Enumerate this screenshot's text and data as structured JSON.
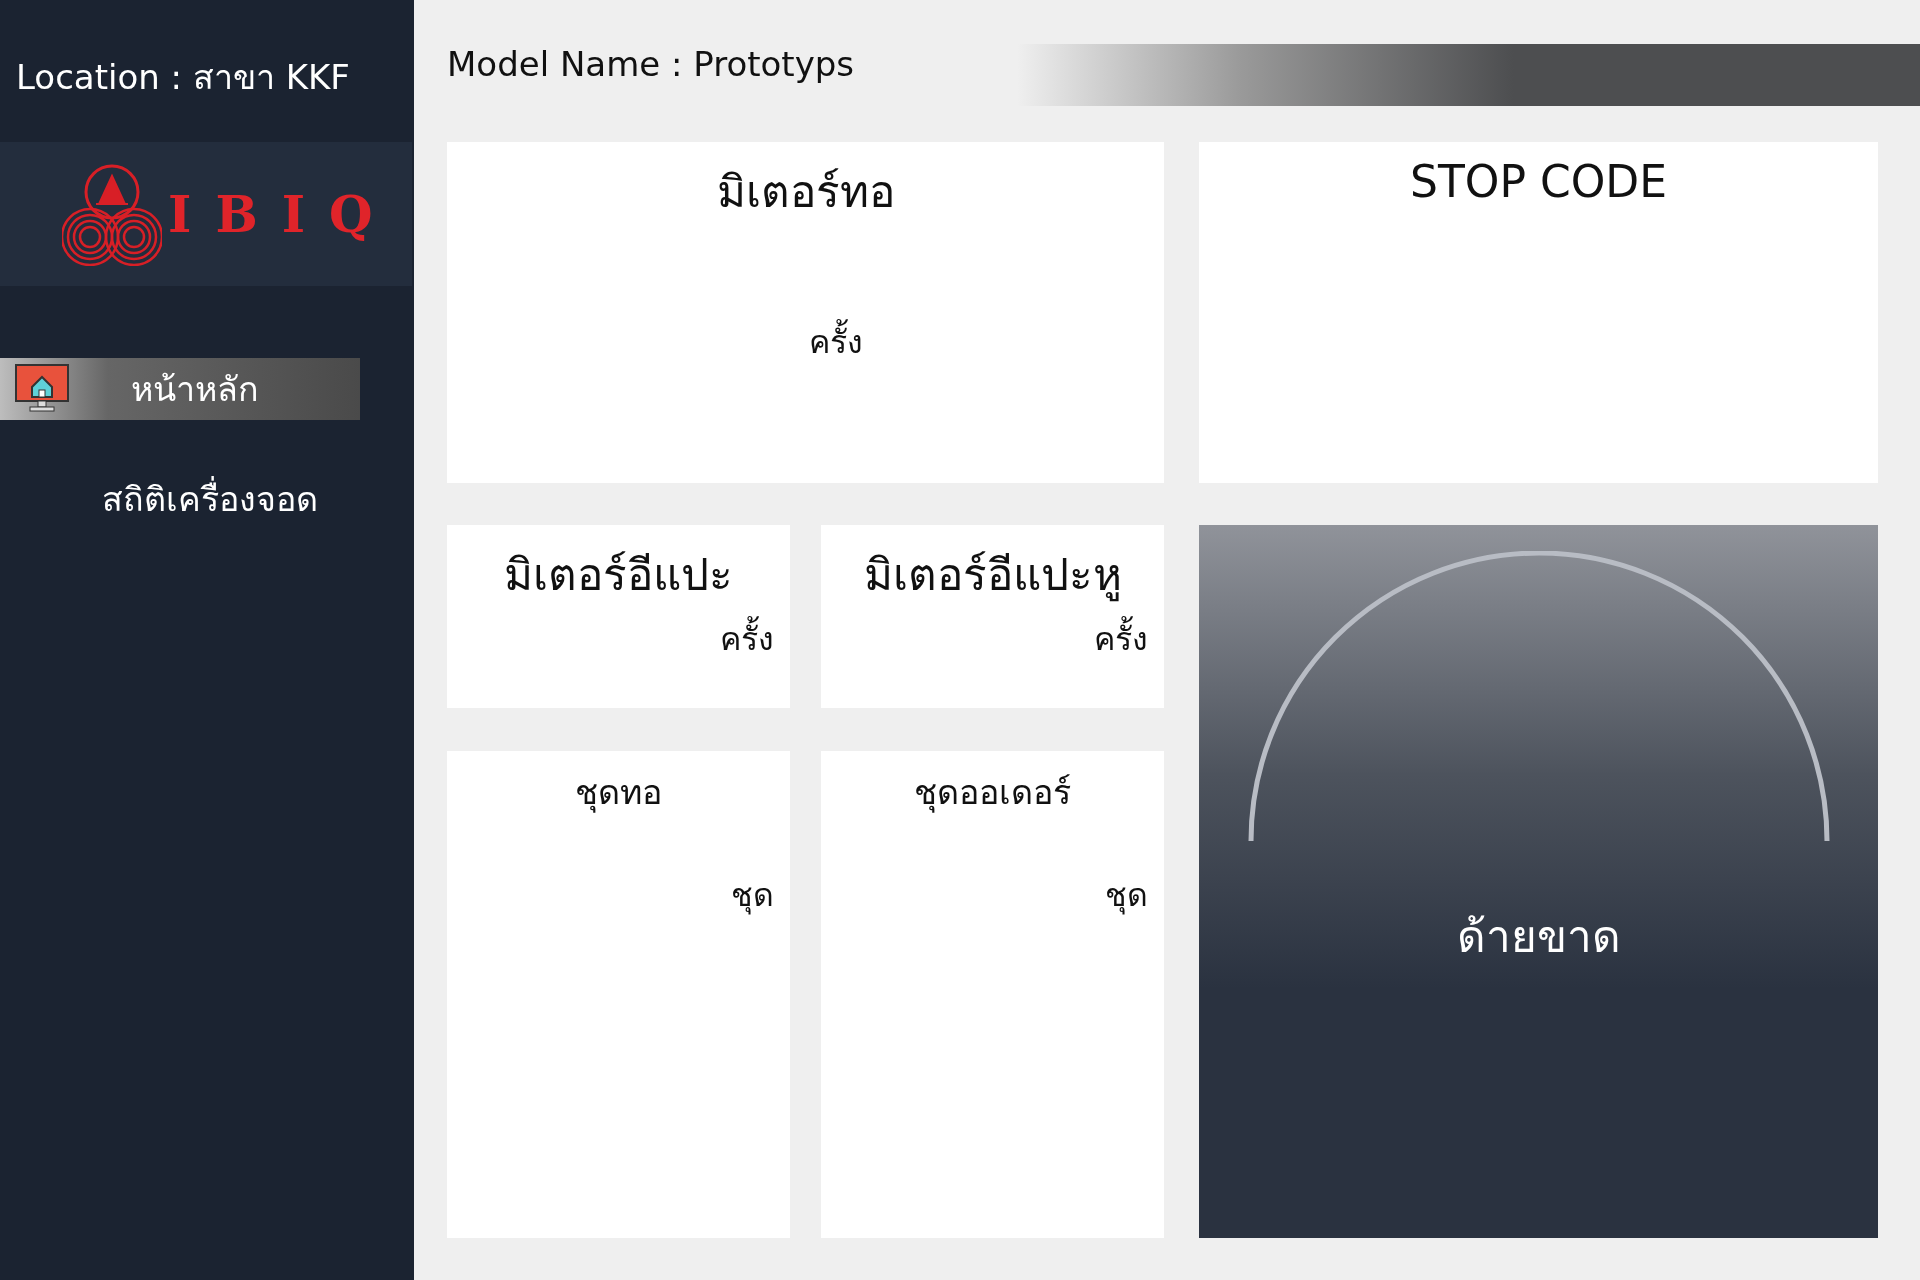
{
  "sidebar": {
    "location": "Location : สาขา KKF",
    "logo_text": "IBIQ",
    "items": [
      {
        "label": "หน้าหลัก",
        "selected": true
      },
      {
        "label": "สถิติเครื่องจอด",
        "selected": false
      }
    ]
  },
  "header": {
    "model_name": "Model Name : Prototyps"
  },
  "cards": {
    "top_left": {
      "title": "มิเตอร์ทอ",
      "unit": "ครั้ง"
    },
    "top_right": {
      "title": "STOP CODE"
    },
    "small": [
      {
        "title": "มิเตอร์อีแปะ",
        "unit": "ครั้ง"
      },
      {
        "title": "มิเตอร์อีแปะหู",
        "unit": "ครั้ง"
      }
    ],
    "tall": [
      {
        "title": "ชุดทอ",
        "unit": "ชุด"
      },
      {
        "title": "ชุดออเดอร์",
        "unit": "ชุด"
      }
    ],
    "gauge": {
      "label": "ด้ายขาด"
    }
  }
}
